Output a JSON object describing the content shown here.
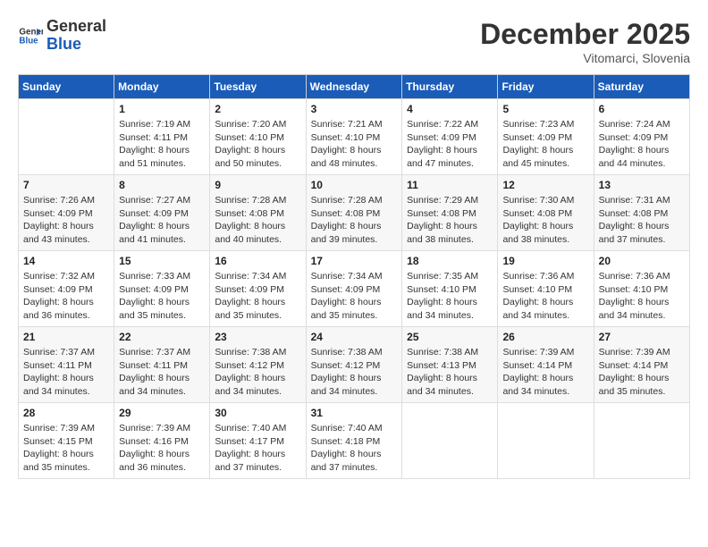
{
  "header": {
    "logo_line1": "General",
    "logo_line2": "Blue",
    "month_year": "December 2025",
    "location": "Vitomarci, Slovenia"
  },
  "weekdays": [
    "Sunday",
    "Monday",
    "Tuesday",
    "Wednesday",
    "Thursday",
    "Friday",
    "Saturday"
  ],
  "weeks": [
    [
      {
        "day": "",
        "info": ""
      },
      {
        "day": "1",
        "info": "Sunrise: 7:19 AM\nSunset: 4:11 PM\nDaylight: 8 hours\nand 51 minutes."
      },
      {
        "day": "2",
        "info": "Sunrise: 7:20 AM\nSunset: 4:10 PM\nDaylight: 8 hours\nand 50 minutes."
      },
      {
        "day": "3",
        "info": "Sunrise: 7:21 AM\nSunset: 4:10 PM\nDaylight: 8 hours\nand 48 minutes."
      },
      {
        "day": "4",
        "info": "Sunrise: 7:22 AM\nSunset: 4:09 PM\nDaylight: 8 hours\nand 47 minutes."
      },
      {
        "day": "5",
        "info": "Sunrise: 7:23 AM\nSunset: 4:09 PM\nDaylight: 8 hours\nand 45 minutes."
      },
      {
        "day": "6",
        "info": "Sunrise: 7:24 AM\nSunset: 4:09 PM\nDaylight: 8 hours\nand 44 minutes."
      }
    ],
    [
      {
        "day": "7",
        "info": "Sunrise: 7:26 AM\nSunset: 4:09 PM\nDaylight: 8 hours\nand 43 minutes."
      },
      {
        "day": "8",
        "info": "Sunrise: 7:27 AM\nSunset: 4:09 PM\nDaylight: 8 hours\nand 41 minutes."
      },
      {
        "day": "9",
        "info": "Sunrise: 7:28 AM\nSunset: 4:08 PM\nDaylight: 8 hours\nand 40 minutes."
      },
      {
        "day": "10",
        "info": "Sunrise: 7:28 AM\nSunset: 4:08 PM\nDaylight: 8 hours\nand 39 minutes."
      },
      {
        "day": "11",
        "info": "Sunrise: 7:29 AM\nSunset: 4:08 PM\nDaylight: 8 hours\nand 38 minutes."
      },
      {
        "day": "12",
        "info": "Sunrise: 7:30 AM\nSunset: 4:08 PM\nDaylight: 8 hours\nand 38 minutes."
      },
      {
        "day": "13",
        "info": "Sunrise: 7:31 AM\nSunset: 4:08 PM\nDaylight: 8 hours\nand 37 minutes."
      }
    ],
    [
      {
        "day": "14",
        "info": "Sunrise: 7:32 AM\nSunset: 4:09 PM\nDaylight: 8 hours\nand 36 minutes."
      },
      {
        "day": "15",
        "info": "Sunrise: 7:33 AM\nSunset: 4:09 PM\nDaylight: 8 hours\nand 35 minutes."
      },
      {
        "day": "16",
        "info": "Sunrise: 7:34 AM\nSunset: 4:09 PM\nDaylight: 8 hours\nand 35 minutes."
      },
      {
        "day": "17",
        "info": "Sunrise: 7:34 AM\nSunset: 4:09 PM\nDaylight: 8 hours\nand 35 minutes."
      },
      {
        "day": "18",
        "info": "Sunrise: 7:35 AM\nSunset: 4:10 PM\nDaylight: 8 hours\nand 34 minutes."
      },
      {
        "day": "19",
        "info": "Sunrise: 7:36 AM\nSunset: 4:10 PM\nDaylight: 8 hours\nand 34 minutes."
      },
      {
        "day": "20",
        "info": "Sunrise: 7:36 AM\nSunset: 4:10 PM\nDaylight: 8 hours\nand 34 minutes."
      }
    ],
    [
      {
        "day": "21",
        "info": "Sunrise: 7:37 AM\nSunset: 4:11 PM\nDaylight: 8 hours\nand 34 minutes."
      },
      {
        "day": "22",
        "info": "Sunrise: 7:37 AM\nSunset: 4:11 PM\nDaylight: 8 hours\nand 34 minutes."
      },
      {
        "day": "23",
        "info": "Sunrise: 7:38 AM\nSunset: 4:12 PM\nDaylight: 8 hours\nand 34 minutes."
      },
      {
        "day": "24",
        "info": "Sunrise: 7:38 AM\nSunset: 4:12 PM\nDaylight: 8 hours\nand 34 minutes."
      },
      {
        "day": "25",
        "info": "Sunrise: 7:38 AM\nSunset: 4:13 PM\nDaylight: 8 hours\nand 34 minutes."
      },
      {
        "day": "26",
        "info": "Sunrise: 7:39 AM\nSunset: 4:14 PM\nDaylight: 8 hours\nand 34 minutes."
      },
      {
        "day": "27",
        "info": "Sunrise: 7:39 AM\nSunset: 4:14 PM\nDaylight: 8 hours\nand 35 minutes."
      }
    ],
    [
      {
        "day": "28",
        "info": "Sunrise: 7:39 AM\nSunset: 4:15 PM\nDaylight: 8 hours\nand 35 minutes."
      },
      {
        "day": "29",
        "info": "Sunrise: 7:39 AM\nSunset: 4:16 PM\nDaylight: 8 hours\nand 36 minutes."
      },
      {
        "day": "30",
        "info": "Sunrise: 7:40 AM\nSunset: 4:17 PM\nDaylight: 8 hours\nand 37 minutes."
      },
      {
        "day": "31",
        "info": "Sunrise: 7:40 AM\nSunset: 4:18 PM\nDaylight: 8 hours\nand 37 minutes."
      },
      {
        "day": "",
        "info": ""
      },
      {
        "day": "",
        "info": ""
      },
      {
        "day": "",
        "info": ""
      }
    ]
  ]
}
